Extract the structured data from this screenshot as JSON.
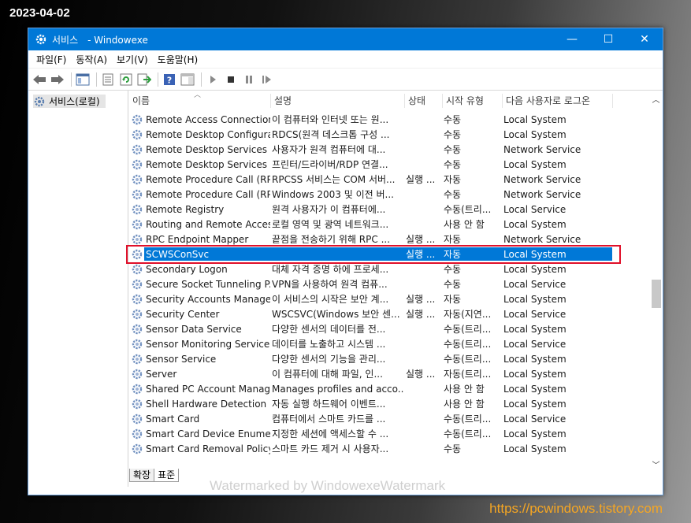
{
  "overlay": {
    "date": "2023-04-02",
    "site_url": "https://pcwindows.tistory.com",
    "watermark": "Watermarked by WindowexeWatermark"
  },
  "window": {
    "title": "서비스",
    "title_suffix": "- Windowexe",
    "controls": {
      "minimize": "—",
      "maximize": "☐",
      "close": "✕"
    }
  },
  "menu": [
    "파일(F)",
    "동작(A)",
    "보기(V)",
    "도움말(H)"
  ],
  "tree": {
    "root_label": "서비스(로컬)"
  },
  "columns": {
    "name": "이름",
    "desc": "설명",
    "status": "상태",
    "startup": "시작 유형",
    "logon": "다음 사용자로 로그온"
  },
  "services": [
    {
      "name": "Remote Access Connection...",
      "desc": "이 컴퓨터와 인터넷 또는 원...",
      "status": "",
      "startup": "수동",
      "logon": "Local System"
    },
    {
      "name": "Remote Desktop Configura...",
      "desc": "RDCS(원격 데스크톱 구성 ...",
      "status": "",
      "startup": "수동",
      "logon": "Local System"
    },
    {
      "name": "Remote Desktop Services",
      "desc": "사용자가 원격 컴퓨터에 대...",
      "status": "",
      "startup": "수동",
      "logon": "Network Service"
    },
    {
      "name": "Remote Desktop Services ...",
      "desc": "프린터/드라이버/RDP 연결...",
      "status": "",
      "startup": "수동",
      "logon": "Local System"
    },
    {
      "name": "Remote Procedure Call (RP...",
      "desc": "RPCSS 서비스는 COM 서버...",
      "status": "실행 ...",
      "startup": "자동",
      "logon": "Network Service"
    },
    {
      "name": "Remote Procedure Call (RP...",
      "desc": "Windows 2003 및 이전 버...",
      "status": "",
      "startup": "수동",
      "logon": "Network Service"
    },
    {
      "name": "Remote Registry",
      "desc": "원격 사용자가 이 컴퓨터에...",
      "status": "",
      "startup": "수동(트리...",
      "logon": "Local Service"
    },
    {
      "name": "Routing and Remote Access",
      "desc": "로컬 영역 및 광역 네트워크...",
      "status": "",
      "startup": "사용 안 함",
      "logon": "Local System"
    },
    {
      "name": "RPC Endpoint Mapper",
      "desc": "끝점을 전송하기 위해 RPC ...",
      "status": "실행 ...",
      "startup": "자동",
      "logon": "Network Service"
    },
    {
      "name": "SCWSConSvc",
      "desc": "",
      "status": "실행 ...",
      "startup": "자동",
      "logon": "Local System",
      "selected": true
    },
    {
      "name": "Secondary Logon",
      "desc": "대체 자격 증명 하에 프로세...",
      "status": "",
      "startup": "수동",
      "logon": "Local System"
    },
    {
      "name": "Secure Socket Tunneling P...",
      "desc": "VPN을 사용하여 원격 컴퓨...",
      "status": "",
      "startup": "수동",
      "logon": "Local Service"
    },
    {
      "name": "Security Accounts Manager",
      "desc": "이 서비스의 시작은 보안 계...",
      "status": "실행 ...",
      "startup": "자동",
      "logon": "Local System"
    },
    {
      "name": "Security Center",
      "desc": "WSCSVC(Windows 보안 센...",
      "status": "실행 ...",
      "startup": "자동(지연...",
      "logon": "Local Service"
    },
    {
      "name": "Sensor Data Service",
      "desc": "다양한 센서의 데이터를 전...",
      "status": "",
      "startup": "수동(트리...",
      "logon": "Local System"
    },
    {
      "name": "Sensor Monitoring Service",
      "desc": "데이터를 노출하고 시스템 ...",
      "status": "",
      "startup": "수동(트리...",
      "logon": "Local Service"
    },
    {
      "name": "Sensor Service",
      "desc": "다양한 센서의 기능을 관리...",
      "status": "",
      "startup": "수동(트리...",
      "logon": "Local System"
    },
    {
      "name": "Server",
      "desc": "이 컴퓨터에 대해 파일, 인...",
      "status": "실행 ...",
      "startup": "자동(트리...",
      "logon": "Local System"
    },
    {
      "name": "Shared PC Account Manager",
      "desc": "Manages profiles and acco...",
      "status": "",
      "startup": "사용 안 함",
      "logon": "Local System"
    },
    {
      "name": "Shell Hardware Detection",
      "desc": "자동 실행 하드웨어 이벤트...",
      "status": "",
      "startup": "사용 안 함",
      "logon": "Local System"
    },
    {
      "name": "Smart Card",
      "desc": "컴퓨터에서 스마트 카드를 ...",
      "status": "",
      "startup": "수동(트리...",
      "logon": "Local Service"
    },
    {
      "name": "Smart Card Device Enumer...",
      "desc": "지정한 세션에 액세스할 수 ...",
      "status": "",
      "startup": "수동(트리...",
      "logon": "Local System"
    },
    {
      "name": "Smart Card Removal Policy",
      "desc": "스마트 카드 제거 시 사용자...",
      "status": "",
      "startup": "수동",
      "logon": "Local System"
    }
  ],
  "tabs": [
    "확장",
    "표준"
  ],
  "colors": {
    "accent": "#0078d7",
    "highlight_box": "#e0102a",
    "url": "#f5a623"
  }
}
